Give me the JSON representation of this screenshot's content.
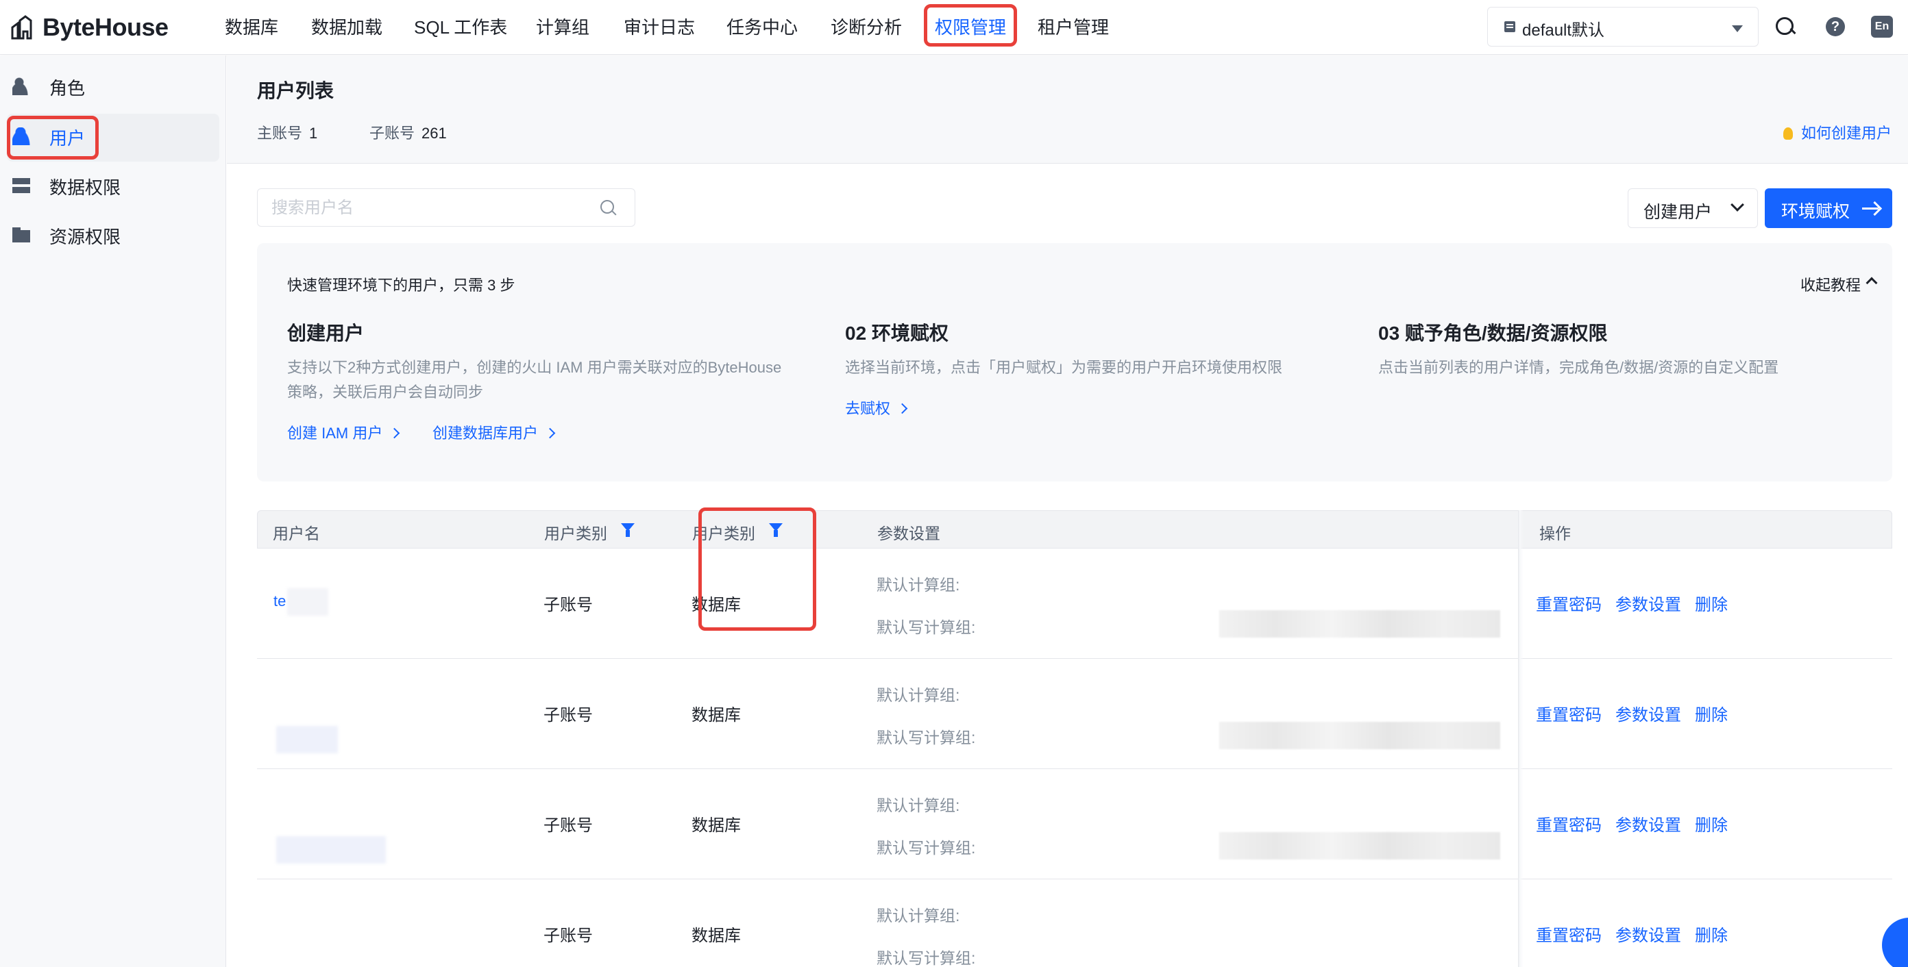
{
  "app": {
    "logo": "ByteHouse"
  },
  "nav": {
    "items": [
      "数据库",
      "数据加载",
      "SQL 工作表",
      "计算组",
      "审计日志",
      "任务中心",
      "诊断分析",
      "权限管理",
      "租户管理"
    ],
    "active": "权限管理"
  },
  "env_selector": {
    "value": "default默认"
  },
  "lang": "En",
  "sidebar": {
    "items": [
      {
        "label": "角色",
        "icon": "role-icon"
      },
      {
        "label": "用户",
        "icon": "user-icon"
      },
      {
        "label": "数据权限",
        "icon": "data-permission-icon"
      },
      {
        "label": "资源权限",
        "icon": "folder-icon"
      }
    ],
    "active": "用户"
  },
  "page": {
    "title": "用户列表",
    "main_account_label": "主账号",
    "main_account_count": "1",
    "sub_account_label": "子账号",
    "sub_account_count": "261",
    "howto": "如何创建用户"
  },
  "toolbar": {
    "search_placeholder": "搜索用户名",
    "create_user": "创建用户",
    "env_auth": "环境赋权"
  },
  "guide": {
    "subtitle": "快速管理环境下的用户，只需 3 步",
    "collapse": "收起教程",
    "steps": [
      {
        "title": "创建用户",
        "desc": "支持以下2种方式创建用户，创建的火山 IAM 用户需关联对应的ByteHouse策略，关联后用户会自动同步",
        "links": [
          "创建 IAM 用户",
          "创建数据库用户"
        ]
      },
      {
        "title": "02 环境赋权",
        "desc": "选择当前环境，点击「用户赋权」为需要的用户开启环境使用权限",
        "links": [
          "去赋权"
        ]
      },
      {
        "title": "03 赋予角色/数据/资源权限",
        "desc": "点击当前列表的用户详情，完成角色/数据/资源的自定义配置",
        "links": []
      }
    ]
  },
  "table": {
    "columns": [
      "用户名",
      "用户类别",
      "用户类别",
      "参数设置",
      "操作"
    ],
    "param_labels": [
      "默认计算组:",
      "默认写计算组:"
    ],
    "actions": [
      "重置密码",
      "参数设置",
      "删除"
    ],
    "rows": [
      {
        "name": "te",
        "type": "子账号",
        "category": "数据库"
      },
      {
        "name": "",
        "type": "子账号",
        "category": "数据库"
      },
      {
        "name": "",
        "type": "子账号",
        "category": "数据库"
      },
      {
        "name": "",
        "type": "子账号",
        "category": "数据库"
      }
    ]
  },
  "colors": {
    "accent": "#1664ff",
    "highlight": "#e8403a"
  }
}
